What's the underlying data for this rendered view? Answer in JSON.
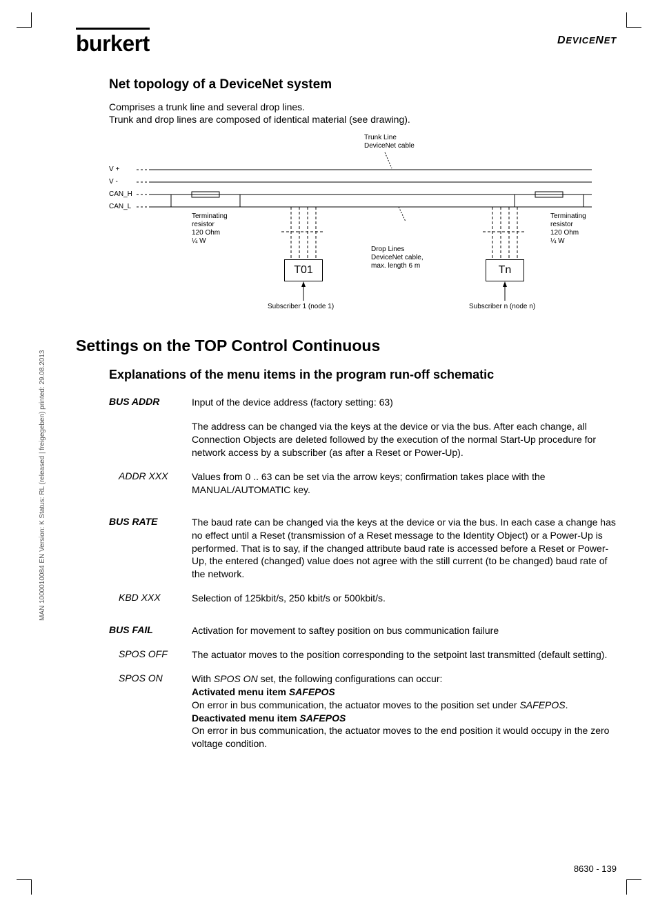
{
  "header": {
    "logo": "burkert",
    "right": "DeviceNet"
  },
  "side_text": "MAN 1000010084 EN Version: K Status: RL (released | freigegeben) printed: 29.08.2013",
  "section1": {
    "title": "Net topology of a DeviceNet system",
    "intro1": "Comprises a trunk line and several drop lines.",
    "intro2": "Trunk and drop lines are composed of identical material (see drawing)."
  },
  "diagram": {
    "trunk": "Trunk Line\nDeviceNet cable",
    "vplus": "V +",
    "vminus": "V -",
    "canh": "CAN_H",
    "canl": "CAN_L",
    "term_left": "Terminating\nresistor\n120 Ohm\n¼ W",
    "term_right": "Terminating\nresistor\n120 Ohm\n¼ W",
    "drop": "Drop Lines\nDeviceNet cable,\nmax. length 6 m",
    "t01": "T01",
    "tn": "Tn",
    "sub1": "Subscriber 1 (node 1)",
    "subn": "Subscriber n (node n)"
  },
  "section2": {
    "title": "Settings on the TOP Control Continuous",
    "subtitle": "Explanations of the menu items in the program run-off schematic"
  },
  "defs": {
    "bus_addr": {
      "term": "BUS ADDR",
      "d1": "Input of the device address (factory setting: 63)",
      "d2": "The address can be changed via the keys at the device or via the bus. After each change, all Connection Objects are deleted followed by the execution of the normal Start-Up procedure for network access by a subscriber (as after a Reset or Power-Up)."
    },
    "addr_xxx": {
      "term": "ADDR XXX",
      "d": "Values from 0 .. 63 can be set via the arrow keys; confirmation takes place with the MANUAL/AUTOMATIC key."
    },
    "bus_rate": {
      "term": "BUS RATE",
      "d": "The baud rate can be changed via the keys at the device or via the bus. In each case a change has no effect until a Reset (transmission of a Reset message to the Identity Object) or a Power-Up is performed. That is to say, if the changed attribute baud rate is accessed before a Reset or Power-Up, the entered (changed) value does not agree with the still current (to be changed) baud rate of the network."
    },
    "kbd_xxx": {
      "term": "KBD XXX",
      "d": "Selection of 125kbit/s, 250 kbit/s or 500kbit/s."
    },
    "bus_fail": {
      "term": "BUS FAIL",
      "d": "Activation for movement to saftey position on bus communication failure"
    },
    "spos_off": {
      "term": "SPOS OFF",
      "d": "The actuator moves to the position corresponding to the setpoint last transmitted (default setting)."
    },
    "spos_on": {
      "term": "SPOS ON",
      "p1a": "With ",
      "p1b": "SPOS ON",
      "p1c": " set, the following configurations can occur:",
      "h1a": "Activated menu item ",
      "h1b": "SAFEPOS",
      "p2a": "On error in bus communication, the actuator moves to the position set under ",
      "p2b": "SAFEPOS",
      "p2c": ".",
      "h2a": "Deactivated menu item ",
      "h2b": "SAFEPOS",
      "p3": "On error in bus communication, the actuator moves to the end position it would occupy in the zero voltage condition."
    }
  },
  "footer": "8630  -  139"
}
